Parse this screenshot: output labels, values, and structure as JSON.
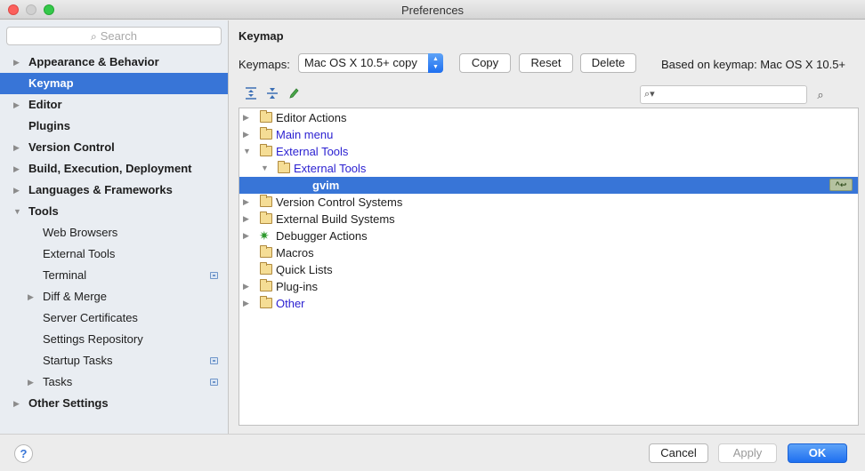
{
  "window": {
    "title": "Preferences"
  },
  "sidebar": {
    "search_placeholder": "Search",
    "items": [
      {
        "label": "Appearance & Behavior",
        "level": 0,
        "arrow": "right"
      },
      {
        "label": "Keymap",
        "level": 0,
        "selected": true
      },
      {
        "label": "Editor",
        "level": 0,
        "arrow": "right"
      },
      {
        "label": "Plugins",
        "level": 0
      },
      {
        "label": "Version Control",
        "level": 0,
        "arrow": "right"
      },
      {
        "label": "Build, Execution, Deployment",
        "level": 0,
        "arrow": "right"
      },
      {
        "label": "Languages & Frameworks",
        "level": 0,
        "arrow": "right"
      },
      {
        "label": "Tools",
        "level": 0,
        "arrow": "down"
      },
      {
        "label": "Web Browsers",
        "level": 1
      },
      {
        "label": "External Tools",
        "level": 1
      },
      {
        "label": "Terminal",
        "level": 1,
        "project_icon": "project-settings-icon"
      },
      {
        "label": "Diff & Merge",
        "level": 1,
        "arrow": "right"
      },
      {
        "label": "Server Certificates",
        "level": 1
      },
      {
        "label": "Settings Repository",
        "level": 1
      },
      {
        "label": "Startup Tasks",
        "level": 1,
        "project_icon": "project-settings-icon"
      },
      {
        "label": "Tasks",
        "level": 1,
        "arrow": "right",
        "project_icon": "project-settings-icon"
      },
      {
        "label": "Other Settings",
        "level": 0,
        "arrow": "right"
      }
    ]
  },
  "main": {
    "title": "Keymap",
    "keymaps_label": "Keymaps:",
    "keymap_selected": "Mac OS X 10.5+ copy",
    "copy_label": "Copy",
    "reset_label": "Reset",
    "delete_label": "Delete",
    "based_on": "Based on keymap: Mac OS X 10.5+",
    "toolbar_icons": [
      "expand-all-icon",
      "collapse-all-icon",
      "edit-shortcut-icon"
    ],
    "filter_icon": "search-icon",
    "find_by_shortcut_icon": "find-shortcut-icon",
    "tree": [
      {
        "label": "Editor Actions",
        "indent": 0,
        "arrow": "right",
        "icon": "folder-editor-icon",
        "link": false
      },
      {
        "label": "Main menu",
        "indent": 0,
        "arrow": "right",
        "icon": "folder-menu-icon",
        "link": true
      },
      {
        "label": "External Tools",
        "indent": 0,
        "arrow": "down",
        "icon": "folder-tools-icon",
        "link": true
      },
      {
        "label": "External Tools",
        "indent": 1,
        "arrow": "down",
        "icon": "folder-icon",
        "link": true
      },
      {
        "label": "gvim",
        "indent": 2,
        "selected": true,
        "shortcut_badge": "^↩"
      },
      {
        "label": "Version Control Systems",
        "indent": 0,
        "arrow": "right",
        "icon": "folder-icon",
        "link": false
      },
      {
        "label": "External Build Systems",
        "indent": 0,
        "arrow": "right",
        "icon": "folder-build-icon",
        "link": false
      },
      {
        "label": "Debugger Actions",
        "indent": 0,
        "arrow": "right",
        "icon": "debugger-icon",
        "link": false
      },
      {
        "label": "Macros",
        "indent": 0,
        "icon": "folder-icon",
        "link": false
      },
      {
        "label": "Quick Lists",
        "indent": 0,
        "icon": "folder-icon",
        "link": false
      },
      {
        "label": "Plug-ins",
        "indent": 0,
        "arrow": "right",
        "icon": "folder-icon",
        "link": false
      },
      {
        "label": "Other",
        "indent": 0,
        "arrow": "right",
        "icon": "folder-other-icon",
        "link": true
      }
    ]
  },
  "footer": {
    "help_label": "?",
    "cancel_label": "Cancel",
    "apply_label": "Apply",
    "ok_label": "OK"
  },
  "colors": {
    "selection": "#3875d7",
    "link": "#2a1fd1",
    "sidebar_bg": "#e9edf2",
    "ok_button": "#1e6ff0"
  }
}
